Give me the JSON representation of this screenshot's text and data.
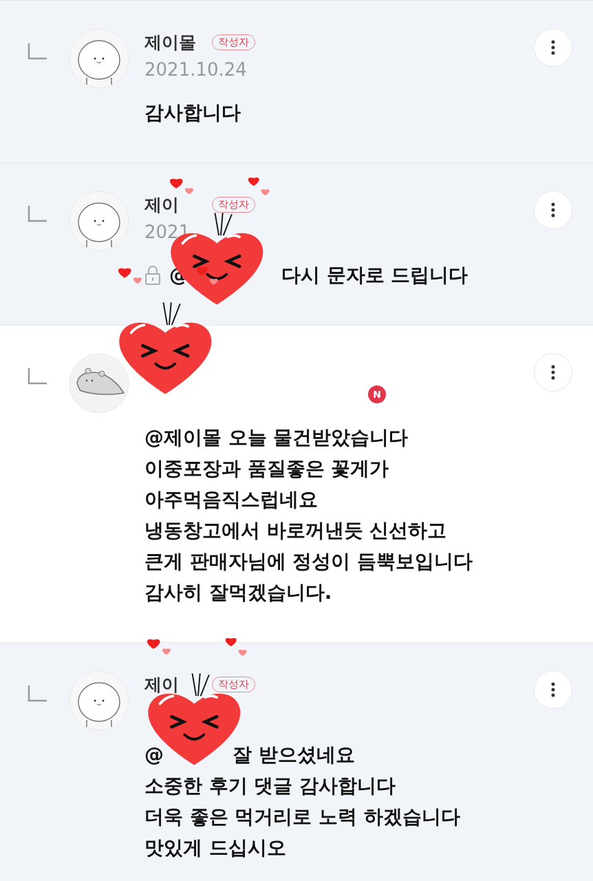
{
  "comments": [
    {
      "highlighted": true,
      "avatar": {
        "kind": "blob"
      },
      "author": "제이몰",
      "author_badge": "작성자",
      "date": "2021.10.24",
      "locked": false,
      "message_lines": [
        "감사합니다"
      ]
    },
    {
      "highlighted": true,
      "avatar": {
        "kind": "blob"
      },
      "author": "제이",
      "author_badge": "작성자",
      "date": "2021",
      "locked": true,
      "mention": "@",
      "message_lines": [
        "다시 문자로 드립니다"
      ]
    },
    {
      "highlighted": false,
      "avatar": {
        "kind": "lizard"
      },
      "new_badge": "N",
      "locked": false,
      "message_lines": [
        "@제이몰 오늘 물건받았습니다",
        "이중포장과 품질좋은 꽃게가",
        "아주먹음직스럽네요",
        "냉동창고에서 바로꺼낸듯 신선하고",
        "큰게 판매자님에 정성이 듬뿍보입니다",
        "감사히 잘먹겠습니다."
      ]
    },
    {
      "highlighted": true,
      "avatar": {
        "kind": "blob"
      },
      "author": "제이",
      "author_badge": "작성자",
      "locked": false,
      "mention": "@",
      "message_lines": [
        "잘 받으셨네요",
        "소중한 후기 댓글 감사합니다",
        "더욱 좋은 먹거리로 노력 하겠습니다",
        "맛있게 드십시오"
      ]
    }
  ]
}
